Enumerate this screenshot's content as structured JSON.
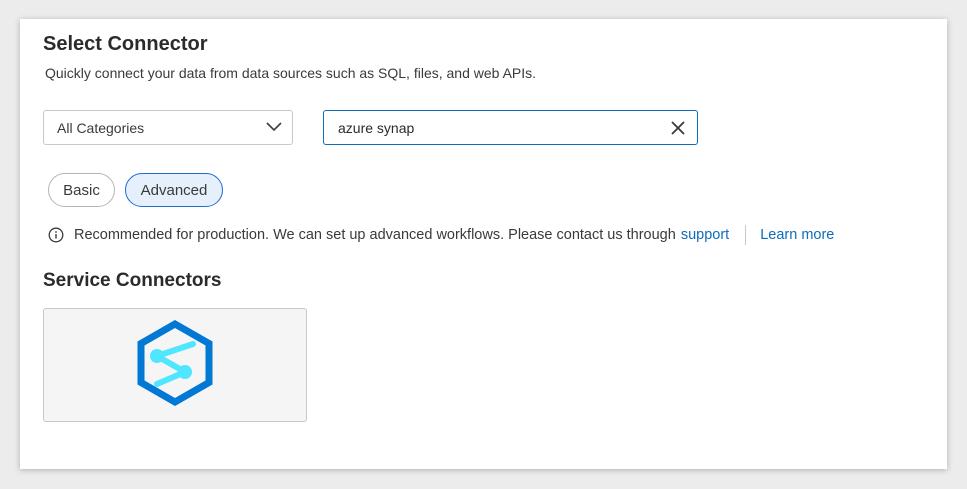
{
  "header": {
    "title": "Select Connector",
    "subtitle": "Quickly connect your data from data sources such as SQL, files, and web APIs."
  },
  "filters": {
    "category_value": "All Categories",
    "search_value": "azure synap"
  },
  "modes": {
    "basic_label": "Basic",
    "advanced_label": "Advanced",
    "selected": "Advanced"
  },
  "info": {
    "message": "Recommended for production. We can set up advanced workflows. Please contact us through",
    "support_link": "support",
    "learn_more_link": "Learn more"
  },
  "section": {
    "title": "Service Connectors"
  },
  "connectors": [
    {
      "icon": "azure-synapse-icon"
    }
  ],
  "colors": {
    "accent": "#0f6cbd",
    "selected_pill_bg": "#e6f0fc",
    "synapse_dark": "#0078d4",
    "synapse_light": "#50e6ff"
  }
}
